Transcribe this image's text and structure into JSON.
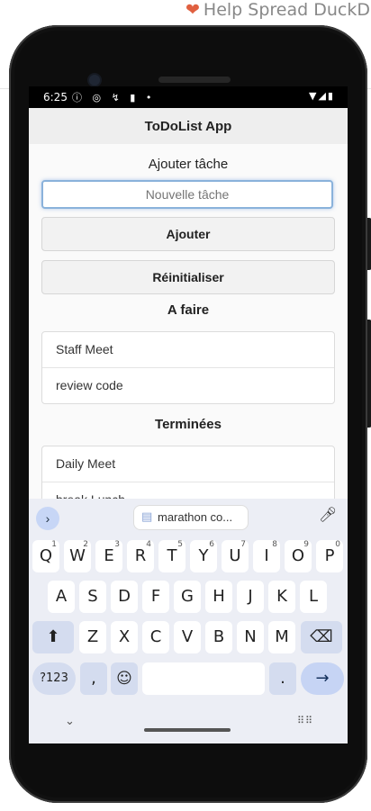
{
  "page": {
    "banner_text": "Help Spread DuckD",
    "banner_heart": "❤"
  },
  "status": {
    "time": "6:25",
    "left_icons": "ⓘ ◎ ↯ ▮ •",
    "right_icons": "▼◢▮"
  },
  "app": {
    "title": "ToDoList App",
    "add_section_label": "Ajouter tâche",
    "task_input_placeholder": "Nouvelle tâche",
    "add_button_label": "Ajouter",
    "reset_button_label": "Réinitialiser",
    "todo_heading": "A faire",
    "todo_items": [
      "Staff Meet",
      "review code"
    ],
    "done_heading": "Terminées",
    "done_items": [
      "Daily Meet",
      "break Lunch"
    ]
  },
  "keyboard": {
    "expand_icon": "chevron-right-icon",
    "suggestion": "marathon co...",
    "mic_icon": "microphone-icon",
    "row1": [
      {
        "k": "Q",
        "n": "1"
      },
      {
        "k": "W",
        "n": "2"
      },
      {
        "k": "E",
        "n": "3"
      },
      {
        "k": "R",
        "n": "4"
      },
      {
        "k": "T",
        "n": "5"
      },
      {
        "k": "Y",
        "n": "6"
      },
      {
        "k": "U",
        "n": "7"
      },
      {
        "k": "I",
        "n": "8"
      },
      {
        "k": "O",
        "n": "9"
      },
      {
        "k": "P",
        "n": "0"
      }
    ],
    "row2": [
      "A",
      "S",
      "D",
      "F",
      "G",
      "H",
      "J",
      "K",
      "L"
    ],
    "row3": [
      "Z",
      "X",
      "C",
      "V",
      "B",
      "N",
      "M"
    ],
    "symbols_label": "?123",
    "comma_label": ",",
    "emoji_glyph": "☺",
    "period_label": ".",
    "enter_glyph": "→",
    "shift_glyph": "⬆",
    "backspace_glyph": "⌫",
    "hide_glyph": "⌄",
    "switch_glyph": "⠿⠿"
  },
  "colors": {
    "focus_border": "#8ab2db",
    "keyboard_bg": "#eceef5",
    "accent_key": "#c6d4f4"
  }
}
